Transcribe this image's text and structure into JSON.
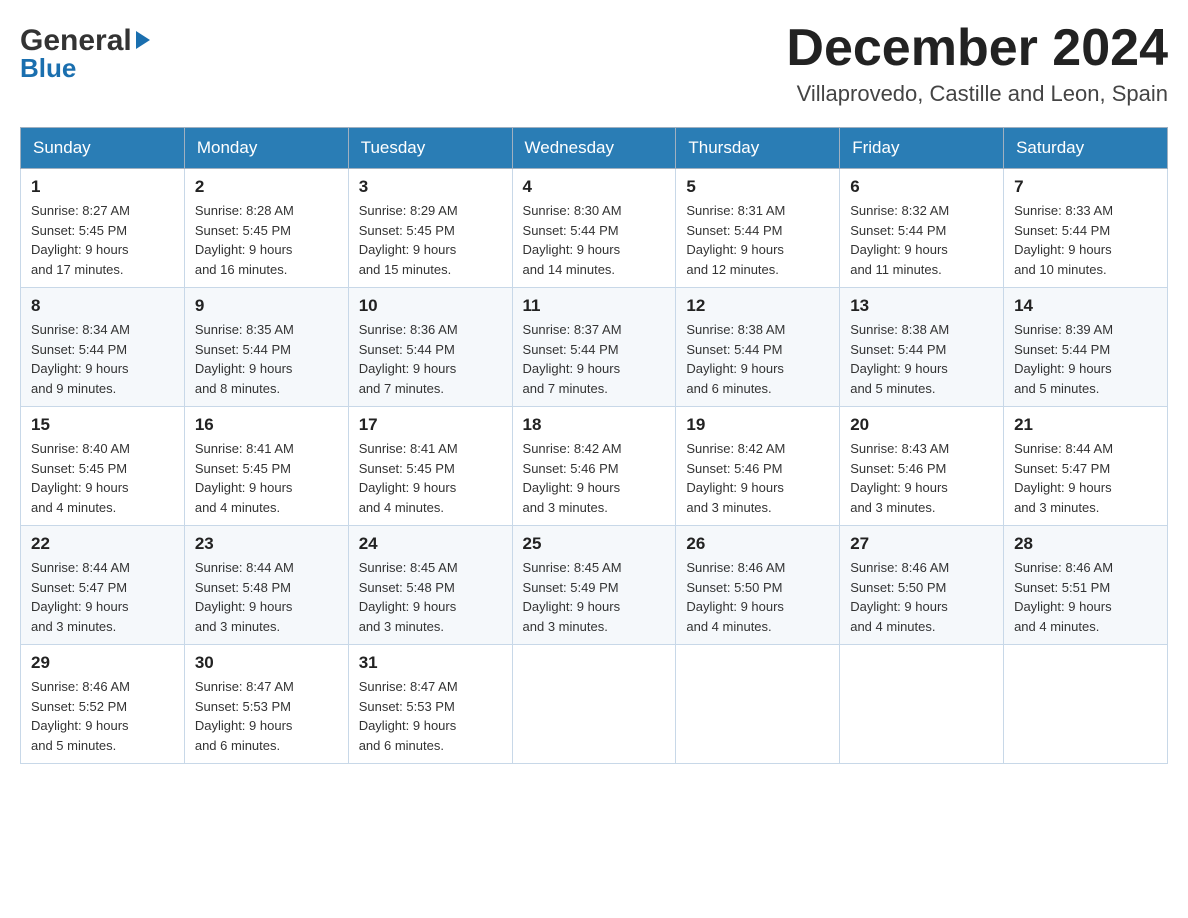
{
  "header": {
    "logo_general": "General",
    "logo_blue": "Blue",
    "month_year": "December 2024",
    "location": "Villaprovedo, Castille and Leon, Spain"
  },
  "weekdays": [
    "Sunday",
    "Monday",
    "Tuesday",
    "Wednesday",
    "Thursday",
    "Friday",
    "Saturday"
  ],
  "weeks": [
    [
      {
        "day": "1",
        "sunrise": "8:27 AM",
        "sunset": "5:45 PM",
        "daylight": "9 hours and 17 minutes."
      },
      {
        "day": "2",
        "sunrise": "8:28 AM",
        "sunset": "5:45 PM",
        "daylight": "9 hours and 16 minutes."
      },
      {
        "day": "3",
        "sunrise": "8:29 AM",
        "sunset": "5:45 PM",
        "daylight": "9 hours and 15 minutes."
      },
      {
        "day": "4",
        "sunrise": "8:30 AM",
        "sunset": "5:44 PM",
        "daylight": "9 hours and 14 minutes."
      },
      {
        "day": "5",
        "sunrise": "8:31 AM",
        "sunset": "5:44 PM",
        "daylight": "9 hours and 12 minutes."
      },
      {
        "day": "6",
        "sunrise": "8:32 AM",
        "sunset": "5:44 PM",
        "daylight": "9 hours and 11 minutes."
      },
      {
        "day": "7",
        "sunrise": "8:33 AM",
        "sunset": "5:44 PM",
        "daylight": "9 hours and 10 minutes."
      }
    ],
    [
      {
        "day": "8",
        "sunrise": "8:34 AM",
        "sunset": "5:44 PM",
        "daylight": "9 hours and 9 minutes."
      },
      {
        "day": "9",
        "sunrise": "8:35 AM",
        "sunset": "5:44 PM",
        "daylight": "9 hours and 8 minutes."
      },
      {
        "day": "10",
        "sunrise": "8:36 AM",
        "sunset": "5:44 PM",
        "daylight": "9 hours and 7 minutes."
      },
      {
        "day": "11",
        "sunrise": "8:37 AM",
        "sunset": "5:44 PM",
        "daylight": "9 hours and 7 minutes."
      },
      {
        "day": "12",
        "sunrise": "8:38 AM",
        "sunset": "5:44 PM",
        "daylight": "9 hours and 6 minutes."
      },
      {
        "day": "13",
        "sunrise": "8:38 AM",
        "sunset": "5:44 PM",
        "daylight": "9 hours and 5 minutes."
      },
      {
        "day": "14",
        "sunrise": "8:39 AM",
        "sunset": "5:44 PM",
        "daylight": "9 hours and 5 minutes."
      }
    ],
    [
      {
        "day": "15",
        "sunrise": "8:40 AM",
        "sunset": "5:45 PM",
        "daylight": "9 hours and 4 minutes."
      },
      {
        "day": "16",
        "sunrise": "8:41 AM",
        "sunset": "5:45 PM",
        "daylight": "9 hours and 4 minutes."
      },
      {
        "day": "17",
        "sunrise": "8:41 AM",
        "sunset": "5:45 PM",
        "daylight": "9 hours and 4 minutes."
      },
      {
        "day": "18",
        "sunrise": "8:42 AM",
        "sunset": "5:46 PM",
        "daylight": "9 hours and 3 minutes."
      },
      {
        "day": "19",
        "sunrise": "8:42 AM",
        "sunset": "5:46 PM",
        "daylight": "9 hours and 3 minutes."
      },
      {
        "day": "20",
        "sunrise": "8:43 AM",
        "sunset": "5:46 PM",
        "daylight": "9 hours and 3 minutes."
      },
      {
        "day": "21",
        "sunrise": "8:44 AM",
        "sunset": "5:47 PM",
        "daylight": "9 hours and 3 minutes."
      }
    ],
    [
      {
        "day": "22",
        "sunrise": "8:44 AM",
        "sunset": "5:47 PM",
        "daylight": "9 hours and 3 minutes."
      },
      {
        "day": "23",
        "sunrise": "8:44 AM",
        "sunset": "5:48 PM",
        "daylight": "9 hours and 3 minutes."
      },
      {
        "day": "24",
        "sunrise": "8:45 AM",
        "sunset": "5:48 PM",
        "daylight": "9 hours and 3 minutes."
      },
      {
        "day": "25",
        "sunrise": "8:45 AM",
        "sunset": "5:49 PM",
        "daylight": "9 hours and 3 minutes."
      },
      {
        "day": "26",
        "sunrise": "8:46 AM",
        "sunset": "5:50 PM",
        "daylight": "9 hours and 4 minutes."
      },
      {
        "day": "27",
        "sunrise": "8:46 AM",
        "sunset": "5:50 PM",
        "daylight": "9 hours and 4 minutes."
      },
      {
        "day": "28",
        "sunrise": "8:46 AM",
        "sunset": "5:51 PM",
        "daylight": "9 hours and 4 minutes."
      }
    ],
    [
      {
        "day": "29",
        "sunrise": "8:46 AM",
        "sunset": "5:52 PM",
        "daylight": "9 hours and 5 minutes."
      },
      {
        "day": "30",
        "sunrise": "8:47 AM",
        "sunset": "5:53 PM",
        "daylight": "9 hours and 6 minutes."
      },
      {
        "day": "31",
        "sunrise": "8:47 AM",
        "sunset": "5:53 PM",
        "daylight": "9 hours and 6 minutes."
      },
      null,
      null,
      null,
      null
    ]
  ],
  "labels": {
    "sunrise_prefix": "Sunrise: ",
    "sunset_prefix": "Sunset: ",
    "daylight_prefix": "Daylight: "
  }
}
